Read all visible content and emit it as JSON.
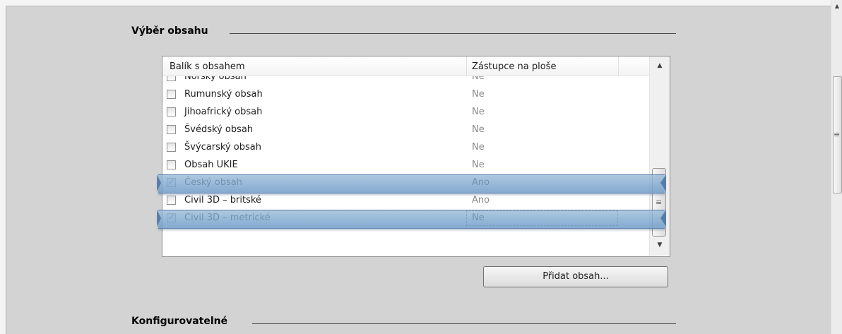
{
  "sections": {
    "content_selection": "Výběr obsahu",
    "configurable": "Konfigurovatelné"
  },
  "list": {
    "columns": [
      "Balík s obsahem",
      "Zástupce na ploše"
    ],
    "rows": [
      {
        "name": "Norský obsah",
        "rep": "Ne",
        "checked": false
      },
      {
        "name": "Rumunský obsah",
        "rep": "Ne",
        "checked": false
      },
      {
        "name": "Jihoafrický obsah",
        "rep": "Ne",
        "checked": false
      },
      {
        "name": "Švédský obsah",
        "rep": "Ne",
        "checked": false
      },
      {
        "name": "Švýcarský obsah",
        "rep": "Ne",
        "checked": false
      },
      {
        "name": "Obsah UKIE",
        "rep": "Ne",
        "checked": false
      },
      {
        "name": "Český obsah",
        "rep": "Ano",
        "checked": true
      },
      {
        "name": "Civil 3D – britské",
        "rep": "Ano",
        "checked": false
      },
      {
        "name": "Civil 3D – metrické",
        "rep": "Ne",
        "checked": true
      }
    ]
  },
  "buttons": {
    "add_content": "Přidat obsah..."
  },
  "icons": {
    "scroll_up": "▲",
    "scroll_down": "▼",
    "check": "✓",
    "grip": "≡"
  }
}
